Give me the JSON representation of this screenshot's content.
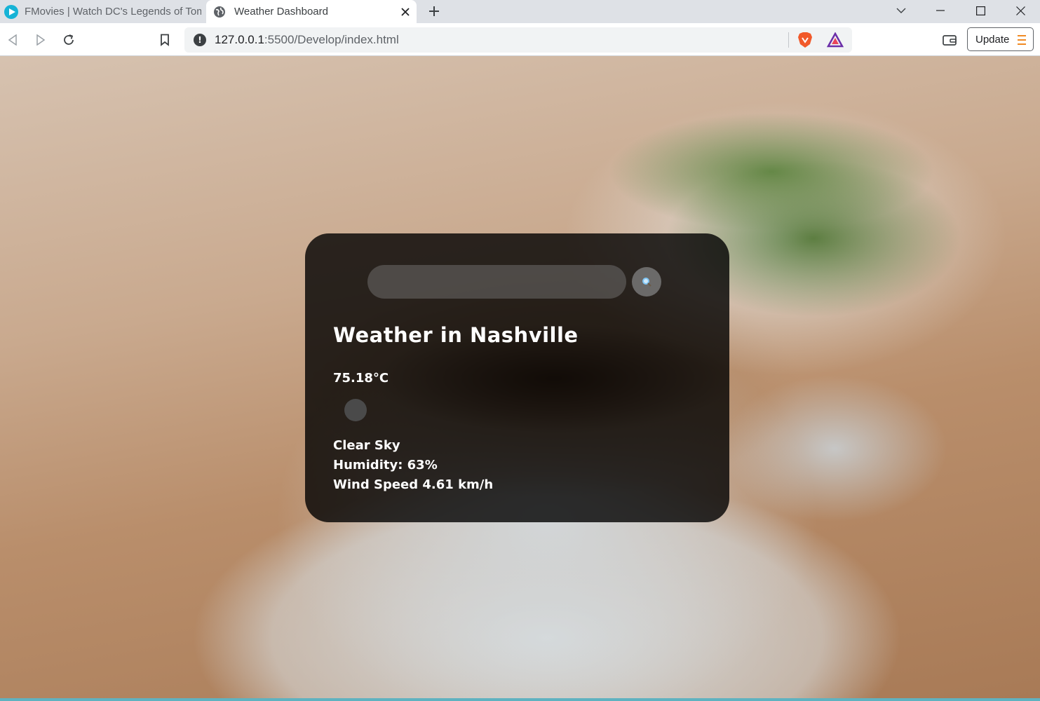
{
  "browser": {
    "tabs": [
      {
        "title": "FMovies | Watch DC's Legends of Tom",
        "active": false
      },
      {
        "title": "Weather Dashboard",
        "active": true
      }
    ],
    "url_host": "127.0.0.1",
    "url_rest": ":5500/Develop/index.html",
    "update_label": "Update"
  },
  "weather": {
    "search_placeholder": "",
    "search_value": "",
    "title": "Weather in Nashville",
    "temperature": "75.18°C",
    "description": "Clear Sky",
    "humidity": "Humidity: 63%",
    "wind": "Wind Speed 4.61 km/h"
  },
  "colors": {
    "card_bg": "rgba(0,0,0,0.8)",
    "accent_orange": "#f08a24",
    "favicon_cyan": "#16b3d6"
  }
}
